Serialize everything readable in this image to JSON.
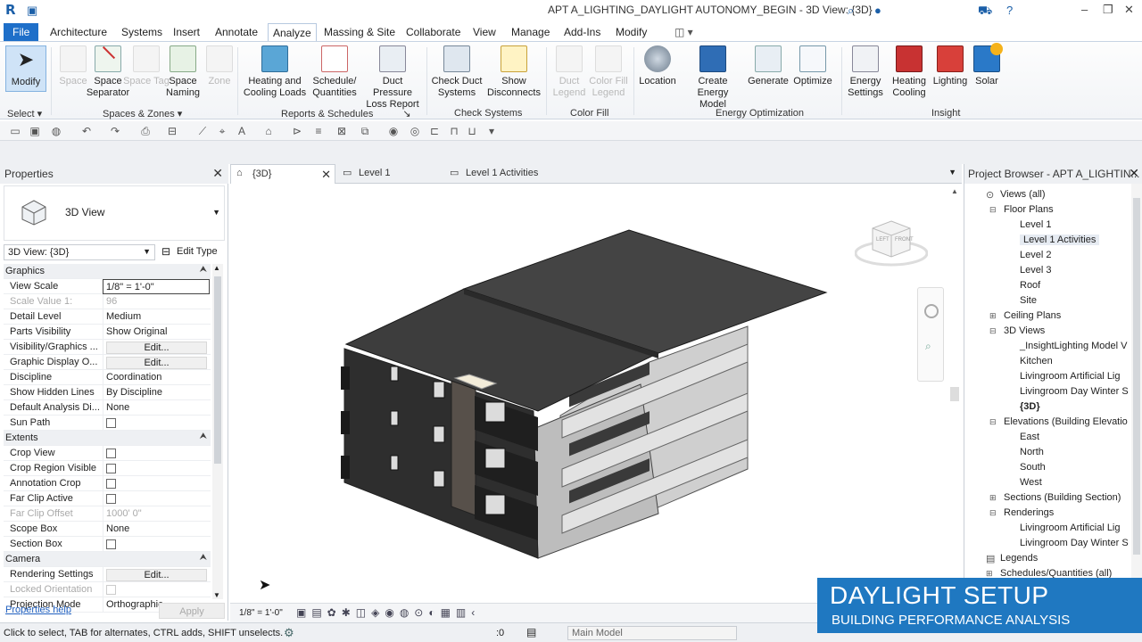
{
  "window": {
    "title": "APT A_LIGHTING_DAYLIGHT AUTONOMY_BEGIN - 3D View: {3D}"
  },
  "ribbon_tabs": [
    "File",
    "Architecture",
    "Systems",
    "Insert",
    "Annotate",
    "Analyze",
    "Massing & Site",
    "Collaborate",
    "View",
    "Manage",
    "Add-Ins",
    "Modify"
  ],
  "active_tab": "Analyze",
  "ribbon": {
    "modify": "Modify",
    "select": "Select",
    "buttons": {
      "space": "Space",
      "space_separator": "Space Separator",
      "space_tag": "Space Tag",
      "space_naming": "Space Naming",
      "zone": "Zone",
      "heating_cooling_loads": "Heating and Cooling Loads",
      "schedule_quantities": "Schedule/ Quantities",
      "duct_pressure": "Duct Pressure Loss Report",
      "check_duct": "Check Duct Systems",
      "show_disconnects": "Show Disconnects",
      "duct_legend": "Duct Legend",
      "color_fill_legend": "Color Fill Legend",
      "location": "Location",
      "create_energy": "Create Energy Model",
      "generate": "Generate",
      "optimize": "Optimize",
      "energy_settings": "Energy Settings",
      "heating_cooling": "Heating Cooling",
      "lighting": "Lighting",
      "solar": "Solar"
    },
    "panels": {
      "spaces_zones": "Spaces & Zones",
      "reports": "Reports & Schedules",
      "check": "Check Systems",
      "color_fill": "Color Fill",
      "energy": "Energy Optimization",
      "insight": "Insight"
    }
  },
  "properties": {
    "title": "Properties",
    "type_name": "3D View",
    "instance_selector": "3D View: {3D}",
    "edit_type": "Edit Type",
    "rows": [
      {
        "kind": "cat",
        "k": "Graphics"
      },
      {
        "k": "View Scale",
        "v": "1/8\" = 1'-0\"",
        "input": true
      },
      {
        "k": "Scale Value 1:",
        "v": "96",
        "dim": true
      },
      {
        "k": "Detail Level",
        "v": "Medium"
      },
      {
        "k": "Parts Visibility",
        "v": "Show Original"
      },
      {
        "k": "Visibility/Graphics ...",
        "v": "Edit...",
        "btn": true
      },
      {
        "k": "Graphic Display O...",
        "v": "Edit...",
        "btn": true
      },
      {
        "k": "Discipline",
        "v": "Coordination"
      },
      {
        "k": "Show Hidden Lines",
        "v": "By Discipline"
      },
      {
        "k": "Default Analysis Di...",
        "v": "None"
      },
      {
        "k": "Sun Path",
        "v": "",
        "chk": true
      },
      {
        "kind": "cat",
        "k": "Extents"
      },
      {
        "k": "Crop View",
        "v": "",
        "chk": true
      },
      {
        "k": "Crop Region Visible",
        "v": "",
        "chk": true
      },
      {
        "k": "Annotation Crop",
        "v": "",
        "chk": true
      },
      {
        "k": "Far Clip Active",
        "v": "",
        "chk": true
      },
      {
        "k": "Far Clip Offset",
        "v": "1000' 0\"",
        "dim": true
      },
      {
        "k": "Scope Box",
        "v": "None"
      },
      {
        "k": "Section Box",
        "v": "",
        "chk": true
      },
      {
        "kind": "cat",
        "k": "Camera"
      },
      {
        "k": "Rendering Settings",
        "v": "Edit...",
        "btn": true
      },
      {
        "k": "Locked Orientation",
        "v": "",
        "chk": true,
        "dim": true
      },
      {
        "k": "Projection Mode",
        "v": "Orthographic"
      }
    ],
    "help_link": "Properties help",
    "apply": "Apply"
  },
  "view_tabs": [
    {
      "label": "{3D}",
      "active": true
    },
    {
      "label": "Level 1",
      "active": false
    },
    {
      "label": "Level 1 Activities",
      "active": false
    }
  ],
  "project_browser": {
    "title": "Project Browser - APT A_LIGHTIN...",
    "items": [
      {
        "label": "Views (all)",
        "lvl": 0
      },
      {
        "label": "Floor Plans",
        "lvl": 1,
        "toggle": "-"
      },
      {
        "label": "Level 1",
        "lvl": 2
      },
      {
        "label": "Level 1 Activities",
        "lvl": 2,
        "sel": true
      },
      {
        "label": "Level 2",
        "lvl": 2
      },
      {
        "label": "Level 3",
        "lvl": 2
      },
      {
        "label": "Roof",
        "lvl": 2
      },
      {
        "label": "Site",
        "lvl": 2
      },
      {
        "label": "Ceiling Plans",
        "lvl": 1,
        "toggle": "+"
      },
      {
        "label": "3D Views",
        "lvl": 1,
        "toggle": "-"
      },
      {
        "label": "_InsightLighting Model V",
        "lvl": 2
      },
      {
        "label": "Kitchen",
        "lvl": 2
      },
      {
        "label": "Livingroom Artificial Lig",
        "lvl": 2
      },
      {
        "label": "Livingroom Day Winter S",
        "lvl": 2
      },
      {
        "label": "{3D}",
        "lvl": 2,
        "bold": true
      },
      {
        "label": "Elevations (Building Elevatio",
        "lvl": 1,
        "toggle": "-"
      },
      {
        "label": "East",
        "lvl": 2
      },
      {
        "label": "North",
        "lvl": 2
      },
      {
        "label": "South",
        "lvl": 2
      },
      {
        "label": "West",
        "lvl": 2
      },
      {
        "label": "Sections (Building Section)",
        "lvl": 1,
        "toggle": "+"
      },
      {
        "label": "Renderings",
        "lvl": 1,
        "toggle": "-"
      },
      {
        "label": "Livingroom Artificial Lig",
        "lvl": 2
      },
      {
        "label": "Livingroom Day Winter S",
        "lvl": 2
      },
      {
        "label": "Legends",
        "lvl": 0
      },
      {
        "label": "Schedules/Quantities (all)",
        "lvl": 0,
        "toggle": "+"
      }
    ]
  },
  "view_control": {
    "scale": "1/8\" = 1'-0\""
  },
  "status": {
    "message": "Click to select, TAB for alternates, CTRL adds, SHIFT unselects.",
    "zero": ":0",
    "model": "Main Model"
  },
  "overlay": {
    "line1": "DAYLIGHT SETUP",
    "line2": "BUILDING PERFORMANCE ANALYSIS"
  },
  "viewcube": {
    "left": "LEFT",
    "front": "FRONT"
  },
  "colors": {
    "accent": "#1e6fc9",
    "overlay": "#1f78c1",
    "roof": "#3d3d3d",
    "facade_dark": "#2c2c2c",
    "facade_light": "#d6d6d6"
  }
}
